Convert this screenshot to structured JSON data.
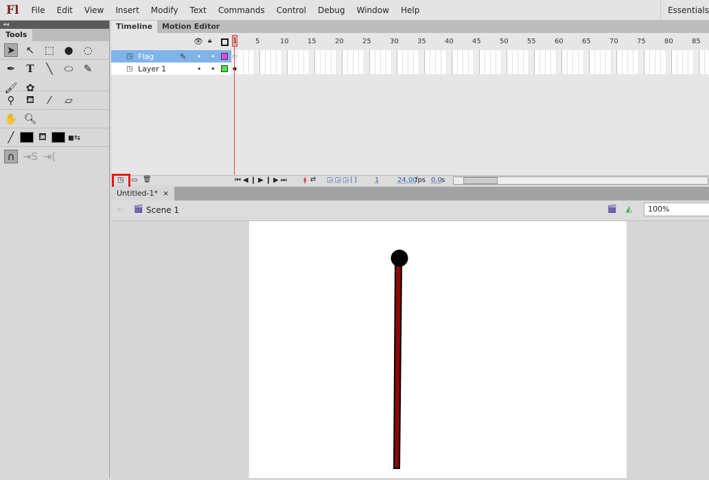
{
  "app": {
    "logo": "Fl",
    "workspace": "Essentials"
  },
  "menu": [
    "File",
    "Edit",
    "View",
    "Insert",
    "Modify",
    "Text",
    "Commands",
    "Control",
    "Debug",
    "Window",
    "Help"
  ],
  "tools": {
    "panel_title": "Tools",
    "collapse": "◂◂"
  },
  "timeline": {
    "tabs": [
      "Timeline",
      "Motion Editor"
    ],
    "frame_numbers": [
      "1",
      "5",
      "10",
      "15",
      "20",
      "25",
      "30",
      "35",
      "40",
      "45",
      "50",
      "55",
      "60",
      "65",
      "70",
      "75",
      "80",
      "85"
    ],
    "layers": [
      {
        "name": "Flag",
        "selected": true,
        "color": "#ee44ee"
      },
      {
        "name": "Layer 1",
        "selected": false,
        "color": "#44ee44"
      }
    ],
    "current_frame": "1",
    "fps": "24.00",
    "fps_unit": "fps",
    "elapsed": "0.0",
    "elapsed_unit": "s"
  },
  "document": {
    "tab": "Untitled-1*",
    "close": "×",
    "scene": "Scene 1",
    "zoom": "100%"
  },
  "colors": {
    "highlight": "#e8141c",
    "pole": "#8b0a0a",
    "selection": "#7eb4ea"
  }
}
